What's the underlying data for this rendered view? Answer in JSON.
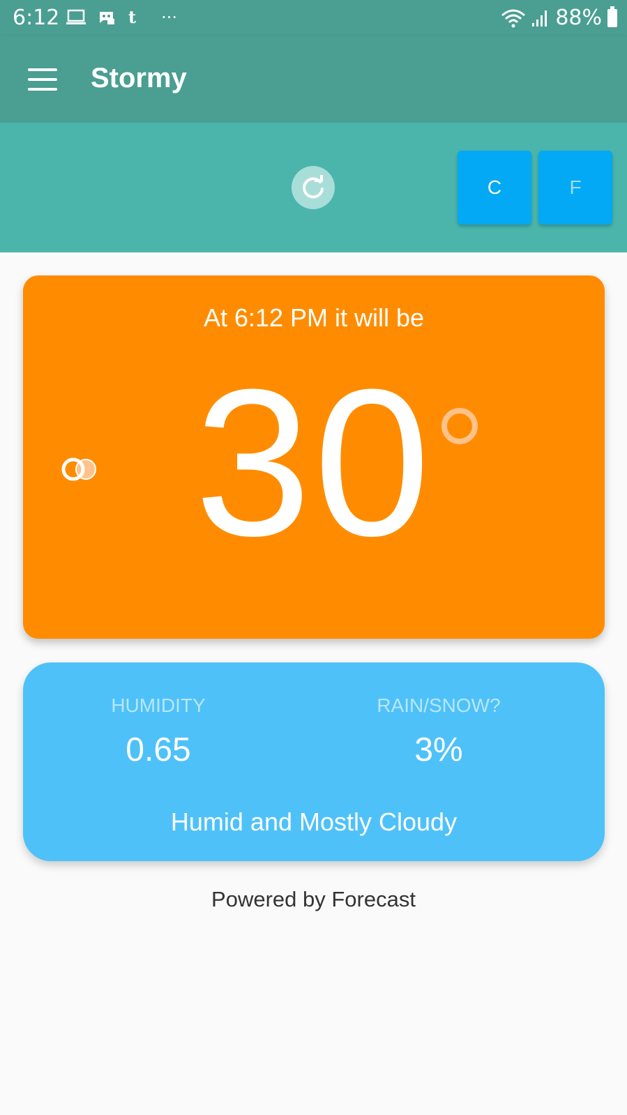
{
  "status_bar": {
    "time": "6:12",
    "more_indicator": "···",
    "battery": "88%",
    "icons": [
      "laptop-icon",
      "discord-icon",
      "tumblr-icon",
      "wifi-icon",
      "signal-icon",
      "battery-icon"
    ]
  },
  "app_bar": {
    "title": "Stormy",
    "menu_icon": "hamburger-menu-icon"
  },
  "controls": {
    "refresh_icon": "refresh-icon",
    "celsius_label": "C",
    "fahrenheit_label": "F",
    "selected_unit": "C"
  },
  "current": {
    "time_text": "At 6:12 PM it will be",
    "temperature": "30",
    "condition_icon": "partly-cloudy-icon"
  },
  "details": {
    "humidity_label": "HUMIDITY",
    "humidity_value": "0.65",
    "rain_label": "RAIN/SNOW?",
    "rain_value": "3%",
    "summary": "Humid and Mostly Cloudy"
  },
  "footer": {
    "text": "Powered by Forecast"
  },
  "colors": {
    "app_bar": "#4a9e92",
    "controls_bg": "#4bb5ac",
    "temp_card": "#ff8c00",
    "details_card": "#4fc1f9",
    "unit_button": "#03a9f4"
  }
}
